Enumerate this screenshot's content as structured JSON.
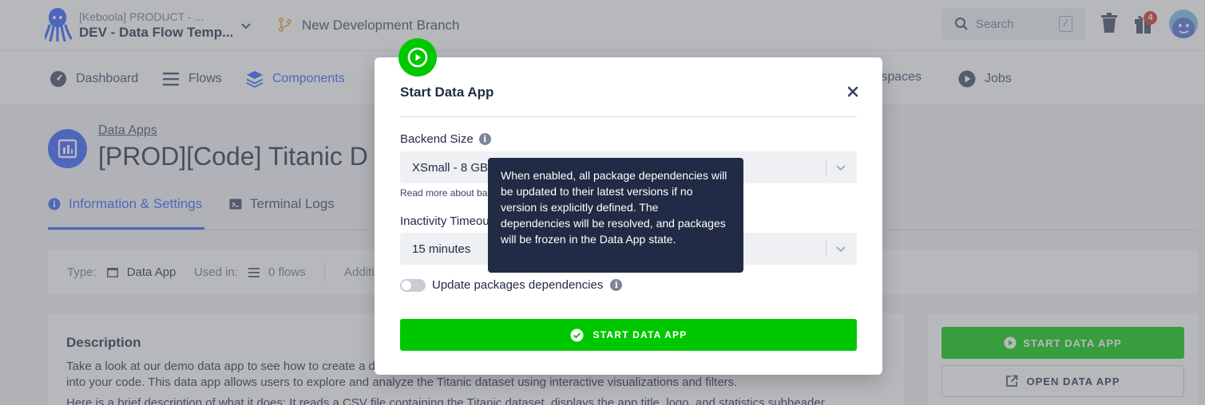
{
  "topbar": {
    "project_org": "[Keboola] PRODUCT - ...",
    "project_name": "DEV - Data Flow Temp...",
    "branch": "New Development Branch",
    "search_label": "Search",
    "search_shortcut": "/",
    "notification_count": "4"
  },
  "nav": {
    "items": [
      {
        "label": "Dashboard"
      },
      {
        "label": "Flows"
      },
      {
        "label": "Components"
      },
      {
        "label": "rkspaces"
      },
      {
        "label": "Jobs"
      }
    ]
  },
  "page": {
    "breadcrumb": "Data Apps",
    "title": "[PROD][Code] Titanic D",
    "tabs": [
      {
        "label": "Information & Settings"
      },
      {
        "label": "Terminal Logs"
      }
    ],
    "info": {
      "type_label": "Type:",
      "type_value": "Data App",
      "used_label": "Used in:",
      "used_value": "0 flows",
      "additional_label": "Additi"
    },
    "description": {
      "title": "Description",
      "line1": "Take a look at our demo data app to see how to create a d",
      "line2": "into your code. This data app allows users to explore and analyze the Titanic dataset using interactive visualizations and filters.",
      "line3": "Here is a brief description of what it does: It reads a CSV file containing the Titanic dataset, displays the app title, logo, and statistics subheader"
    },
    "side": {
      "start_label": "START DATA APP",
      "open_label": "OPEN DATA APP"
    }
  },
  "modal": {
    "title": "Start Data App",
    "backend_label": "Backend Size",
    "backend_value": "XSmall - 8 GB",
    "backend_help": "Read more about ba",
    "timeout_label": "Inactivity Timeou",
    "timeout_value": "15 minutes",
    "toggle_label": "Update packages dependencies",
    "toggle_on": false,
    "primary_label": "START DATA APP",
    "info_glyph": "i"
  },
  "tooltip": {
    "text": "When enabled, all package dependencies will be updated to their latest versions if no version is explicitly defined. The dependencies will be resolved, and packages will be frozen in the Data App state."
  },
  "colors": {
    "accent_blue": "#2e5bff",
    "success_green": "#00c800",
    "tooltip_bg": "#222b45",
    "badge_red": "#d52a2a"
  }
}
